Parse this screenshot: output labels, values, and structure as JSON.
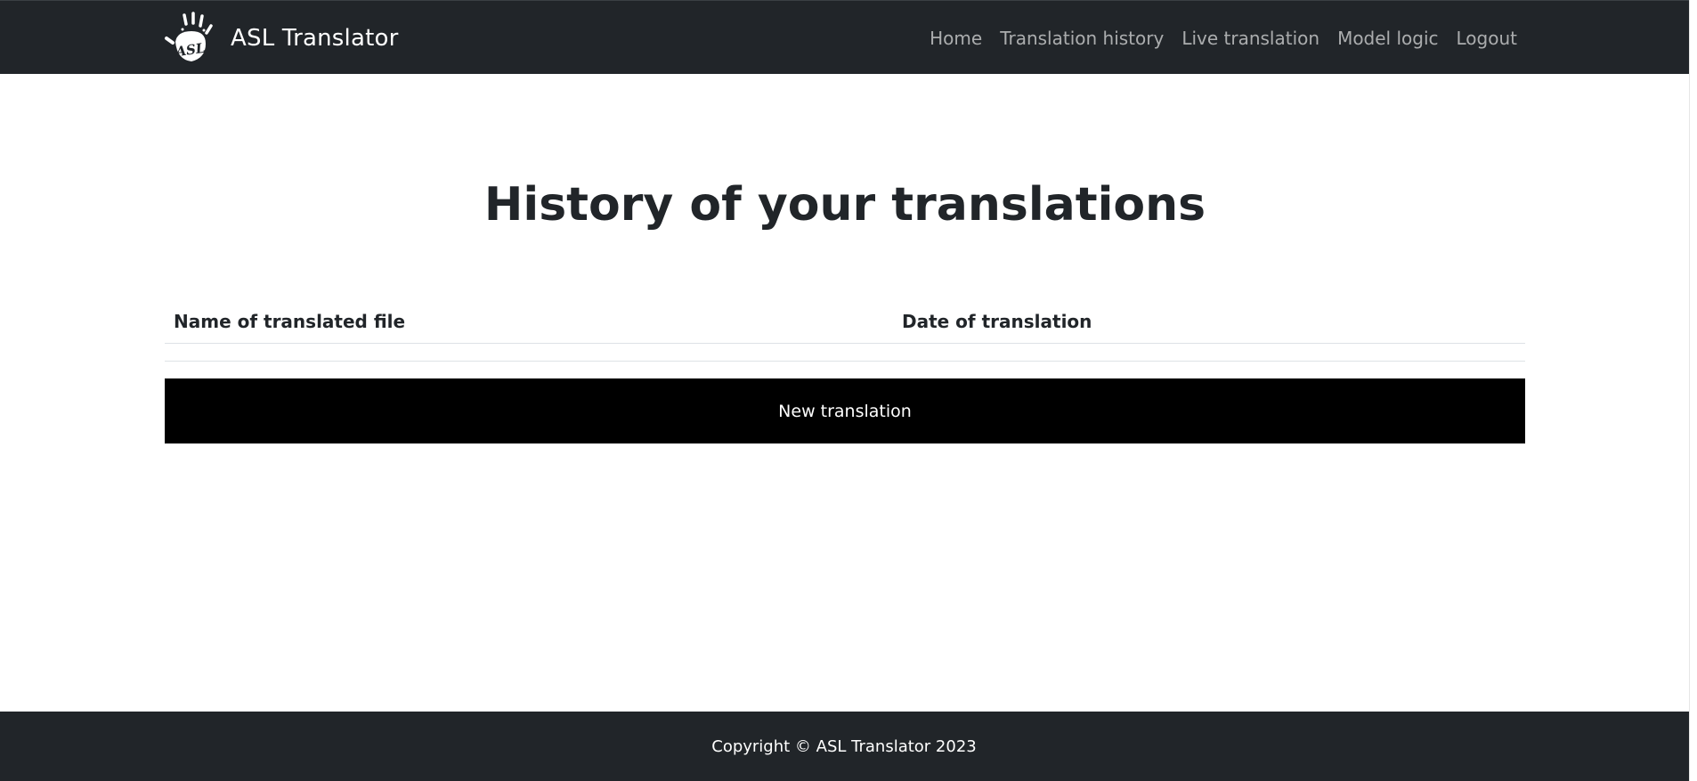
{
  "navbar": {
    "brand": {
      "logo_icon": "asl-hand-logo",
      "logo_text": "ASL",
      "title": "ASL Translator"
    },
    "links": [
      {
        "label": "Home"
      },
      {
        "label": "Translation history"
      },
      {
        "label": "Live translation"
      },
      {
        "label": "Model logic"
      },
      {
        "label": "Logout"
      }
    ]
  },
  "main": {
    "title": "History of your translations",
    "table": {
      "columns": [
        "Name of translated file",
        "Date of translation"
      ],
      "rows": []
    },
    "new_translation_label": "New translation"
  },
  "footer": {
    "copyright": "Copyright © ASL Translator 2023"
  },
  "colors": {
    "navbar_bg": "#212529",
    "nav_link": "#9a9da0",
    "button_bg": "#000000",
    "text": "#212529"
  }
}
